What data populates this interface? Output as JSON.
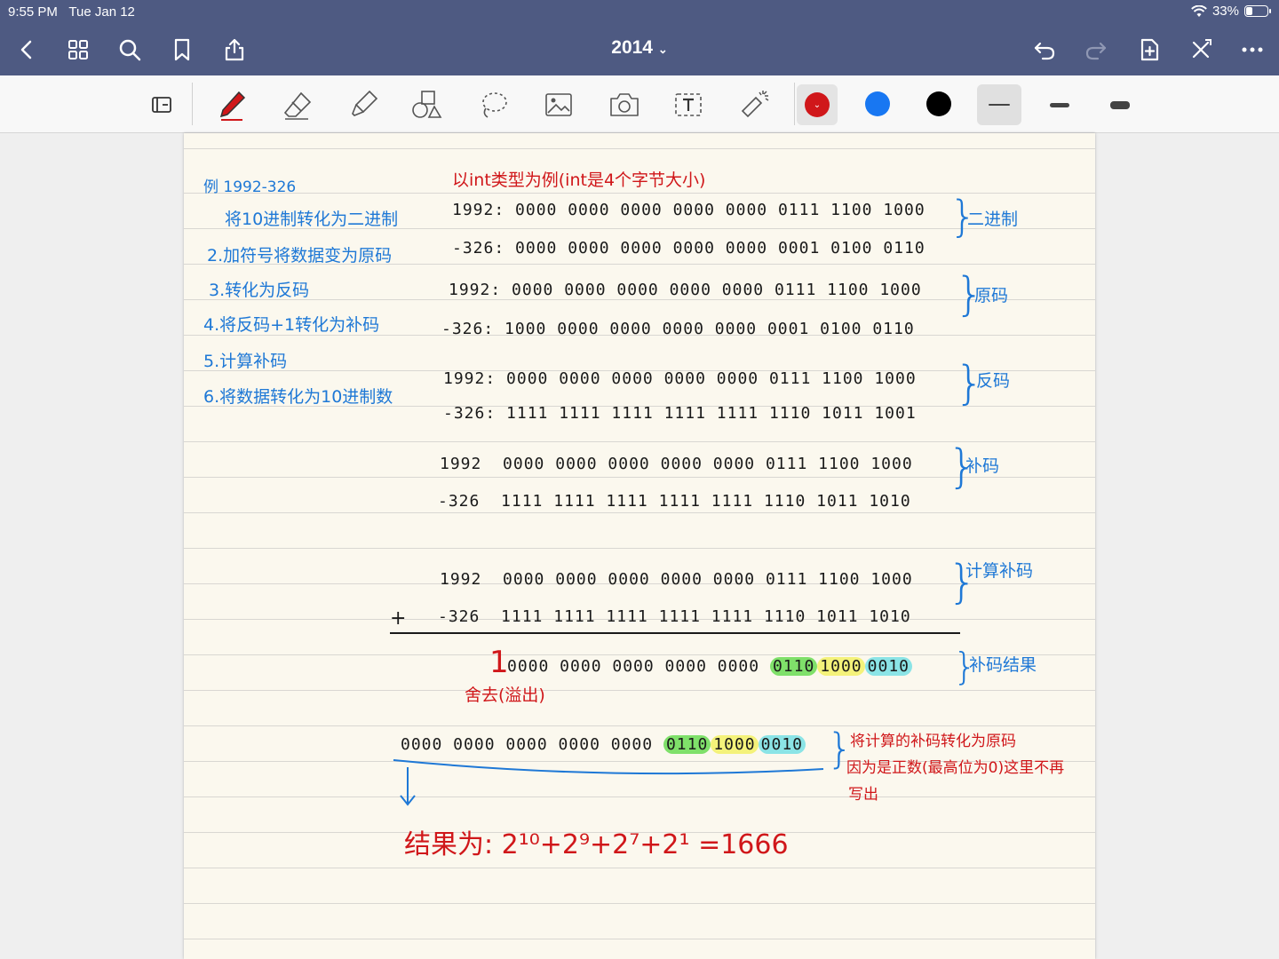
{
  "status": {
    "time": "9:55 PM",
    "date": "Tue Jan 12",
    "battery": "33%",
    "battery_level": 0.33
  },
  "nav": {
    "title": "2014",
    "icons": [
      "chevron-left-icon",
      "grid-icon",
      "search-icon",
      "bookmark-icon",
      "share-icon",
      "undo-icon",
      "redo-icon",
      "add-page-icon",
      "close-icon",
      "more-icon"
    ]
  },
  "toolbar": {
    "tools": [
      "lasso-select-icon",
      "pen-icon",
      "eraser-icon",
      "highlighter-icon",
      "shapes-icon",
      "lasso-icon",
      "image-icon",
      "camera-icon",
      "text-icon",
      "laser-pointer-icon"
    ],
    "colors": [
      "#d0171a",
      "#1877f2",
      "#000000"
    ],
    "selected_color": "#d0171a"
  },
  "notes": {
    "left_title": "例 1992-326",
    "steps": [
      "将10进制转化为二进制",
      "2.加符号将数据变为原码",
      "3.转化为反码",
      "4.将反码+1转化为补码",
      "5.计算补码",
      "6.将数据转化为10进制数"
    ],
    "heading": "以int类型为例(int是4个字节大小)",
    "binary": {
      "a_label": "1992:",
      "a": "0000 0000 0000 0000 0000 0111 1100 1000",
      "b_label": "-326:",
      "b": "0000 0000 0000 0000 0000 0001 0100 0110",
      "tag": "二进制"
    },
    "original": {
      "a_label": "1992:",
      "a": "0000 0000 0000 0000 0000 0111 1100 1000",
      "b_label": "-326:",
      "b": "1000 0000 0000 0000 0000 0001 0100 0110",
      "tag": "原码"
    },
    "ones": {
      "a_label": "1992:",
      "a": "0000 0000 0000 0000 0000 0111 1100 1000",
      "b_label": "-326:",
      "b": "1111 1111 1111 1111 1111 1110 1011 1001",
      "tag": "反码"
    },
    "twos": {
      "a_label": "1992",
      "a": "0000 0000 0000 0000 0000 0111 1100 1000",
      "b_label": "-326",
      "b": "1111 1111 1111 1111 1111 1110 1011 1010",
      "tag": "补码"
    },
    "calc": {
      "a_label": "1992",
      "a": "0000 0000 0000 0000 0000 0111 1100 1000",
      "plus": "+",
      "b_label": "-326",
      "b": "1111 1111 1111 1111 1111 1110 1011 1010",
      "tag": "计算补码"
    },
    "result": {
      "carry": "1",
      "prefix": "0000 0000 0000 0000 0000",
      "g": "0110",
      "y": "1000",
      "c": "0010",
      "tag": "补码结果",
      "overflow_note": "舍去(溢出)"
    },
    "final": {
      "prefix": "0000 0000 0000 0000 0000",
      "g": "0110",
      "y": "1000",
      "c": "0010",
      "note1": "将计算的补码转化为原码",
      "note2": "因为是正数(最高位为0)这里不再",
      "note3": "写出"
    },
    "answer": "结果为: 2¹⁰+2⁹+2⁷+2¹ =1666"
  }
}
